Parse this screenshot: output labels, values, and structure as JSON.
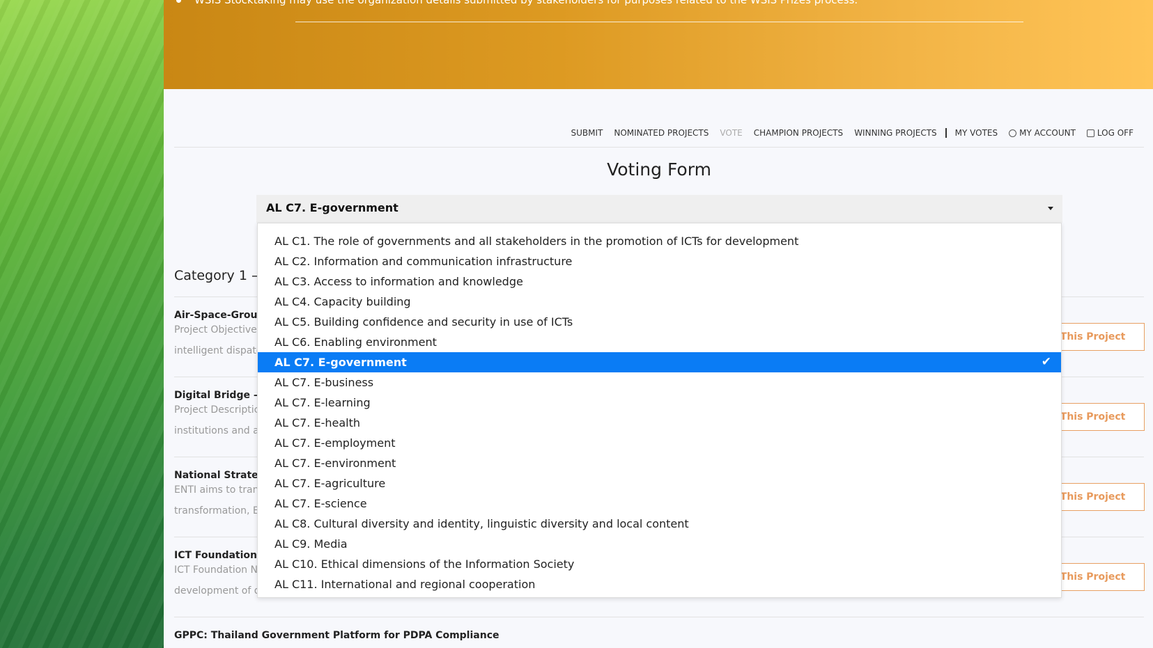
{
  "banner": {
    "text": "WSIS Stocktaking may use the organization details submitted by stakeholders for purposes related to the WSIS Prizes process."
  },
  "nav": {
    "items": [
      "SUBMIT",
      "NOMINATED PROJECTS",
      "VOTE",
      "CHAMPION PROJECTS",
      "WINNING PROJECTS",
      "MY VOTES",
      "MY ACCOUNT",
      "LOG OFF"
    ]
  },
  "page_title": "Voting Form",
  "select": {
    "value": "AL C7. E-government",
    "options": [
      "AL C1. The role of governments and all stakeholders in the promotion of ICTs for development",
      "AL C2. Information and communication infrastructure",
      "AL C3. Access to information and knowledge",
      "AL C4. Capacity building",
      "AL C5. Building confidence and security in use of ICTs",
      "AL C6. Enabling environment",
      "AL C7. E-government",
      "AL C7. E-business",
      "AL C7. E-learning",
      "AL C7. E-health",
      "AL C7. E-employment",
      "AL C7. E-environment",
      "AL C7. E-agriculture",
      "AL C7. E-science",
      "AL C8. Cultural diversity and identity, linguistic diversity and local content",
      "AL C9. Media",
      "AL C10. Ethical dimensions of the Information Society",
      "AL C11. International and regional cooperation"
    ],
    "check_glyph": "✔"
  },
  "category_title": "Category 1 —",
  "projects": [
    {
      "title": "Air-Space-Groun",
      "line1": "Project Objective:",
      "line2": "intelligent dispatc",
      "button": "r This Project"
    },
    {
      "title": "Digital Bridge – N",
      "line1": "Project Descriptic",
      "line2": "institutions and a",
      "button": "r This Project"
    },
    {
      "title": "National Strategy",
      "line1": "ENTI aims to trans",
      "line2": "transformation, EN",
      "button": "r This Project"
    },
    {
      "title": "ICT Foundation N",
      "line1": "ICT Foundation Ne",
      "line2": "development of d",
      "button": "r This Project"
    },
    {
      "title": "GPPC: Thailand Government Platform for PDPA Compliance",
      "line1": "",
      "line2": "",
      "button": ""
    }
  ],
  "colors": {
    "selected_option": "#0a7cf5",
    "vote_button": "#e89a5c",
    "banner_start": "#c98714",
    "banner_end": "#ffc457"
  }
}
